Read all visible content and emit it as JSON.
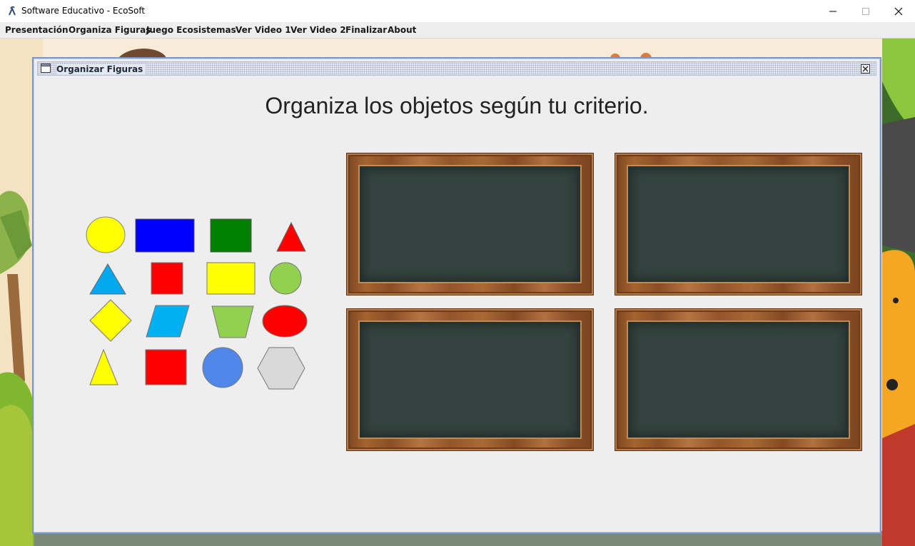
{
  "window": {
    "title": "Software Educativo - EcoSoft",
    "controls": [
      "minimize",
      "maximize",
      "close"
    ]
  },
  "menu": {
    "items": [
      {
        "label": "Presentación"
      },
      {
        "label": "Organiza Figuras"
      },
      {
        "label": "Juego Ecosistemas"
      },
      {
        "label": "Ver Video 1"
      },
      {
        "label": "Ver Video 2"
      },
      {
        "label": "Finalizar"
      },
      {
        "label": "About"
      }
    ]
  },
  "internal_frame": {
    "title": "Organizar Figuras",
    "heading": "Organiza los objetos según tu criterio."
  },
  "shapes": [
    {
      "kind": "circle",
      "color": "#ffff00"
    },
    {
      "kind": "rectangle",
      "color": "#0000ff"
    },
    {
      "kind": "square",
      "color": "#008000"
    },
    {
      "kind": "triangle",
      "color": "#ff0000"
    },
    {
      "kind": "triangle",
      "color": "#00a8f0"
    },
    {
      "kind": "square",
      "color": "#ff0000"
    },
    {
      "kind": "rectangle",
      "color": "#ffff00"
    },
    {
      "kind": "circle",
      "color": "#92d050"
    },
    {
      "kind": "diamond",
      "color": "#ffff00"
    },
    {
      "kind": "parallelogram",
      "color": "#00b0f0"
    },
    {
      "kind": "trapezoid",
      "color": "#92d050"
    },
    {
      "kind": "ellipse",
      "color": "#ff0000"
    },
    {
      "kind": "triangle",
      "color": "#ffff00"
    },
    {
      "kind": "square",
      "color": "#ff0000"
    },
    {
      "kind": "circle",
      "color": "#4f86e8"
    },
    {
      "kind": "hexagon",
      "color": "#d9d9d9"
    }
  ],
  "boards": [
    {
      "name": "board-1"
    },
    {
      "name": "board-2"
    },
    {
      "name": "board-3"
    },
    {
      "name": "board-4"
    }
  ]
}
